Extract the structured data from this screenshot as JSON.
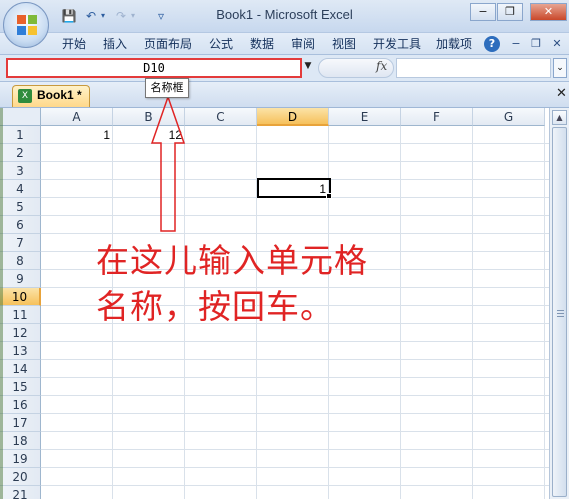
{
  "window": {
    "title": "Book1 - Microsoft Excel",
    "controls": {
      "minimize": "−",
      "restore": "❐",
      "close": "✕"
    }
  },
  "quick_access": {
    "save_icon": "💾",
    "undo_icon": "↶",
    "redo_icon": "↷",
    "dropdown_icon": "▾",
    "customize_icon": "▿"
  },
  "ribbon_tabs": [
    "开始",
    "插入",
    "页面布局",
    "公式",
    "数据",
    "审阅",
    "视图",
    "开发工具",
    "加载项"
  ],
  "ribbon_right": {
    "help_icon": "?",
    "minimize": "−",
    "restore": "❐",
    "close": "✕"
  },
  "formula_bar": {
    "name_box": "D10",
    "fx": "fx",
    "formula": "",
    "dropdown_icon": "▼",
    "expand_icon": "⌄"
  },
  "workbook": {
    "tab_label": "Book1 *",
    "icon": "X",
    "close_icon": "✕"
  },
  "tooltip": "名称框",
  "columns": [
    "A",
    "B",
    "C",
    "D",
    "E",
    "F",
    "G"
  ],
  "rows": [
    "1",
    "2",
    "3",
    "4",
    "5",
    "6",
    "7",
    "8",
    "9",
    "10",
    "11",
    "12",
    "13",
    "14",
    "15",
    "16",
    "17",
    "18",
    "19",
    "20",
    "21"
  ],
  "selected_column": "D",
  "selected_row": "10",
  "cells": {
    "A1": "1",
    "B1": "12",
    "D4": "1"
  },
  "annotation": {
    "line1": "在这儿输入单元格",
    "line2": "名称，按回车。",
    "color": "#e02424"
  },
  "scrollbar": {
    "up_icon": "▲"
  }
}
